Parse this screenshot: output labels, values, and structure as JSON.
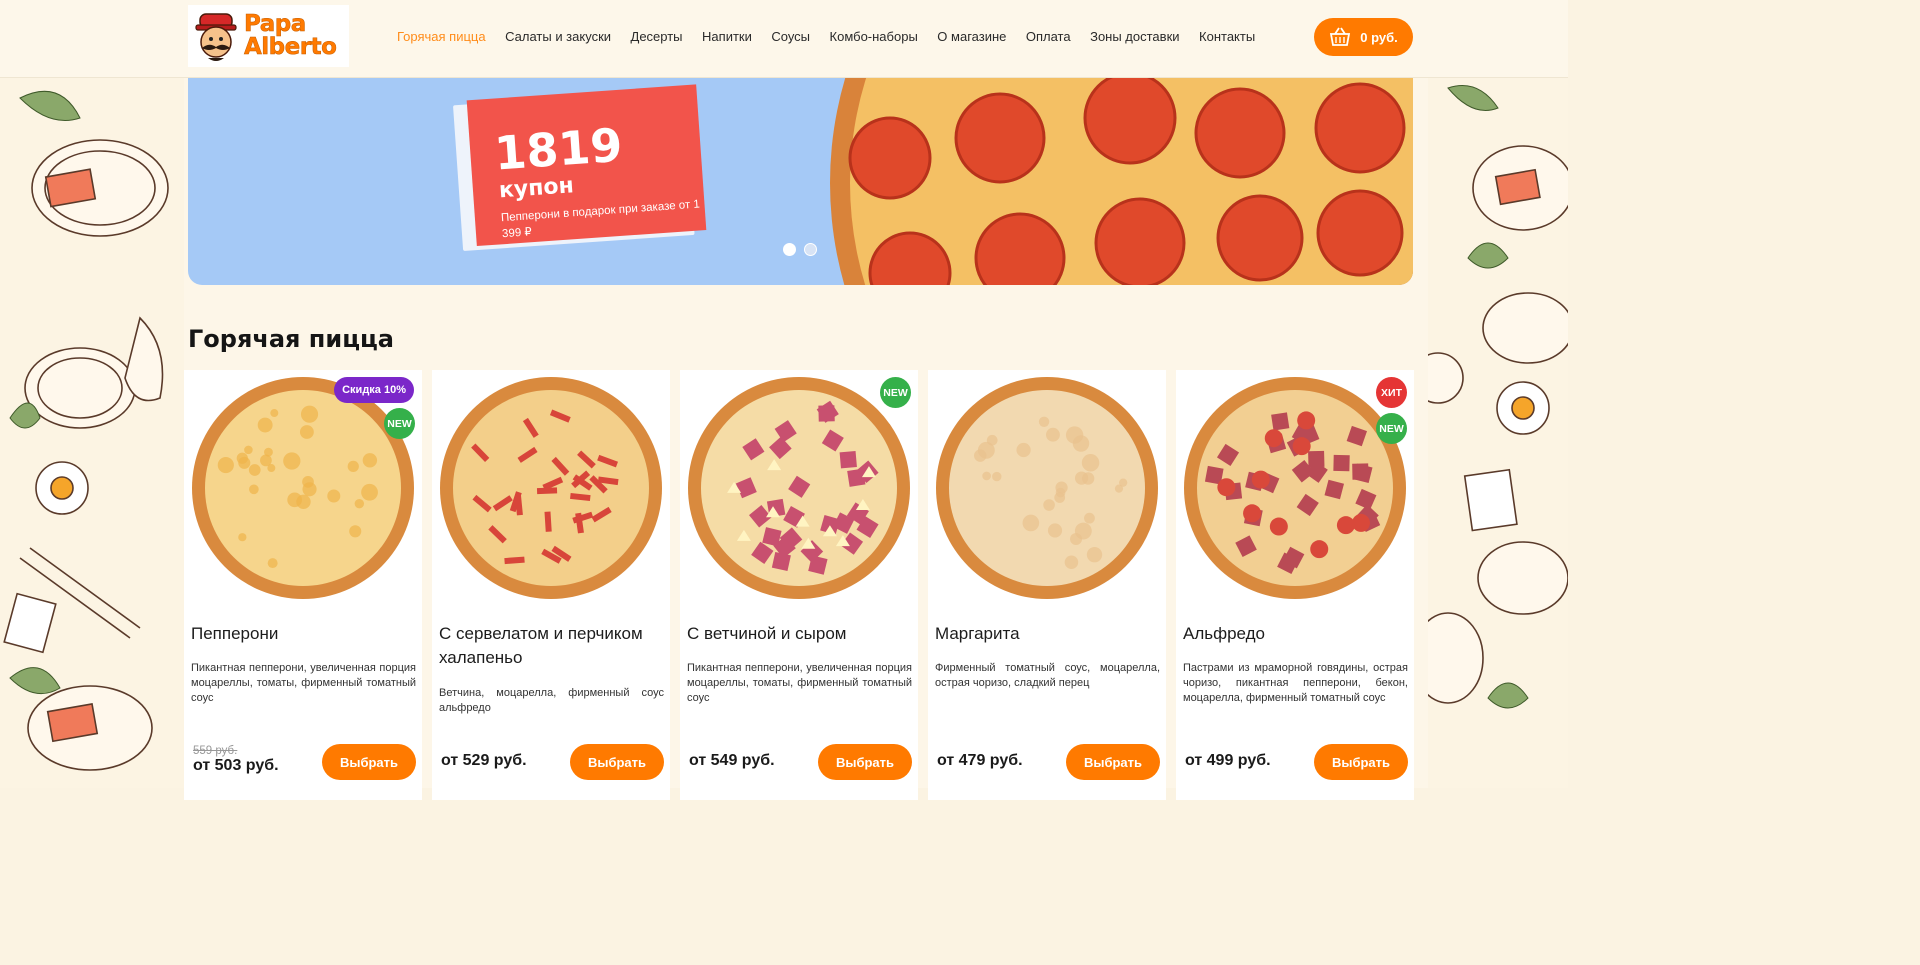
{
  "header": {
    "logo_text_line1": "Papa",
    "logo_text_line2": "Alberto",
    "nav": [
      {
        "label": "Горячая пицца",
        "active": true
      },
      {
        "label": "Салаты и закуски"
      },
      {
        "label": "Десерты"
      },
      {
        "label": "Напитки"
      },
      {
        "label": "Соусы"
      },
      {
        "label": "Комбо-наборы"
      },
      {
        "label": "О магазине"
      },
      {
        "label": "Оплата"
      },
      {
        "label": "Зоны доставки"
      },
      {
        "label": "Контакты"
      }
    ],
    "cart_total": "0 руб."
  },
  "banner": {
    "coupon_number": "1819",
    "coupon_word": "купон",
    "coupon_description": "Пепперони в подарок при заказе от 1 399 ₽",
    "slides": 2,
    "active_slide": 1
  },
  "section": {
    "title": "Горячая пицца"
  },
  "products": [
    {
      "name": "Пепперони",
      "description": "Пикантная пепперони, увеличенная порция моцареллы, томаты, фирменный томатный соус",
      "old_price": "559 руб.",
      "price": "от 503 руб.",
      "button": "Выбрать",
      "badges": [
        "Скидка 10%",
        "NEW"
      ],
      "topping": "cheese"
    },
    {
      "name": "С сервелатом и перчиком халапеньо",
      "description": "Ветчина, моцарелла, фирменный соус альфредо",
      "price": "от 529 руб.",
      "button": "Выбрать",
      "badges": [],
      "topping": "strips"
    },
    {
      "name": "С ветчиной и сыром",
      "description": "Пикантная пепперони, увеличенная порция моцареллы, томаты, фирменный томатный соус",
      "price": "от 549 руб.",
      "button": "Выбрать",
      "badges": [
        "NEW"
      ],
      "topping": "ham"
    },
    {
      "name": "Маргарита",
      "description": "Фирменный томатный соус, моцарелла, острая чоризо, сладкий перец",
      "price": "от 479 руб.",
      "button": "Выбрать",
      "badges": [],
      "topping": "chicken"
    },
    {
      "name": "Альфредо",
      "description": "Пастрами из мраморной говядины, острая чоризо, пикантная пепперони, бекон, моцарелла, фирменный томатный соус",
      "price": "от 499 руб.",
      "button": "Выбрать",
      "badges": [
        "ХИТ",
        "NEW"
      ],
      "topping": "meat"
    }
  ],
  "colors": {
    "accent": "#ff7a00",
    "nav_active": "#ff8c1a",
    "badge_new": "#35b04a",
    "badge_hit": "#e53535",
    "badge_sale": "#7b27c9",
    "coupon_red": "#f2544b",
    "banner_blue": "#a5c9f6"
  }
}
